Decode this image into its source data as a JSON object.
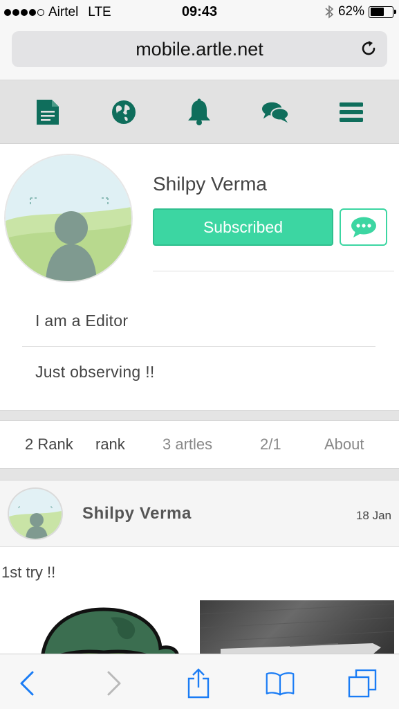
{
  "status_bar": {
    "carrier": "Airtel",
    "network": "LTE",
    "time": "09:43",
    "battery_percent": "62%",
    "battery_level": 0.62,
    "signal_bars_filled": 4,
    "icons": [
      "signal-dots-icon",
      "bluetooth-icon",
      "battery-icon"
    ]
  },
  "browser": {
    "url": "mobile.artle.net",
    "reload_icon": "reload-icon"
  },
  "app_nav": {
    "items": [
      {
        "icon": "document-icon"
      },
      {
        "icon": "globe-icon"
      },
      {
        "icon": "bell-icon"
      },
      {
        "icon": "chat-bubbles-icon"
      },
      {
        "icon": "menu-icon"
      }
    ],
    "color": "#0f6e5c"
  },
  "profile": {
    "name": "Shilpy Verma",
    "subscribe_label": "Subscribed",
    "message_icon": "message-icon",
    "bio_line_1": "I am a Editor",
    "bio_line_2": "Just observing !!",
    "accent": "#3cd6a2"
  },
  "stats": {
    "items": [
      "2 Rank",
      "rank",
      "3 artles",
      "2/1",
      "About"
    ]
  },
  "post": {
    "author": "Shilpy Verma",
    "date": "18 Jan",
    "text": "1st try !!"
  },
  "toolbar": {
    "items": [
      {
        "icon": "back-icon"
      },
      {
        "icon": "forward-icon"
      },
      {
        "icon": "share-icon"
      },
      {
        "icon": "bookmarks-icon"
      },
      {
        "icon": "tabs-icon"
      }
    ],
    "color": "#1a7cf5"
  }
}
